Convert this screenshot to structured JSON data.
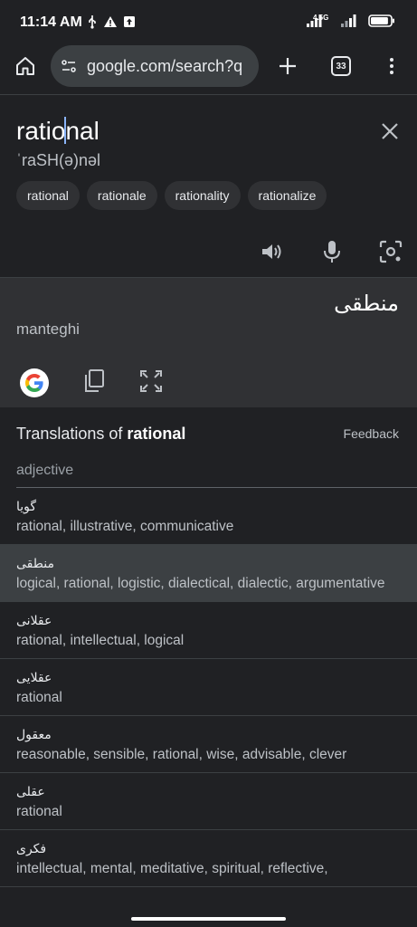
{
  "status": {
    "time": "11:14 AM",
    "network": "4.5G",
    "battery_level": 0.9
  },
  "toolbar": {
    "url": "google.com/search?q",
    "tabs_count": "33"
  },
  "search": {
    "query_before_cursor": "ratio",
    "query_after_cursor": "nal",
    "phonetic": "ˈraSH(ə)nəl",
    "chips": [
      "rational",
      "rationale",
      "rationality",
      "rationalize"
    ]
  },
  "translation": {
    "word": "منطقی",
    "romanization": "manteghi"
  },
  "translations_section": {
    "heading_prefix": "Translations of ",
    "heading_word": "rational",
    "feedback": "Feedback",
    "part_of_speech": "adjective",
    "rows": [
      {
        "word": "گویا",
        "synonyms": "rational, illustrative, communicative",
        "highlight": false
      },
      {
        "word": "منطقی",
        "synonyms": "logical, rational, logistic, dialectical, dialectic, argumentative",
        "highlight": true
      },
      {
        "word": "عقلانی",
        "synonyms": "rational, intellectual, logical",
        "highlight": false
      },
      {
        "word": "عقلایی",
        "synonyms": "rational",
        "highlight": false
      },
      {
        "word": "معقول",
        "synonyms": "reasonable, sensible, rational, wise, advisable, clever",
        "highlight": false
      },
      {
        "word": "عقلی",
        "synonyms": "rational",
        "highlight": false
      },
      {
        "word": "فکری",
        "synonyms": "intellectual, mental, meditative, spiritual, reflective,",
        "highlight": false
      }
    ]
  }
}
